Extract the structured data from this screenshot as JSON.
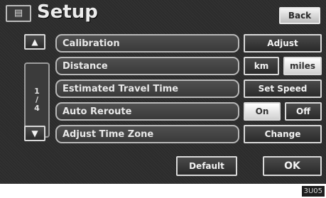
{
  "header": {
    "icon": "menu-list-icon",
    "title": "Setup",
    "back_label": "Back"
  },
  "pager": {
    "up_icon": "arrow-up-icon",
    "down_icon": "arrow-down-icon",
    "current": "1",
    "separator": "/",
    "total": "4"
  },
  "rows": [
    {
      "label": "Calibration",
      "buttons": [
        "Adjust"
      ]
    },
    {
      "label": "Distance",
      "buttons": [
        "km",
        "miles"
      ],
      "selected": "miles"
    },
    {
      "label": "Estimated Travel Time",
      "buttons": [
        "Set Speed"
      ]
    },
    {
      "label": "Auto Reroute",
      "buttons": [
        "On",
        "Off"
      ],
      "selected": "On"
    },
    {
      "label": "Adjust Time Zone",
      "buttons": [
        "Change"
      ]
    }
  ],
  "footer": {
    "default_label": "Default",
    "ok_label": "OK"
  },
  "image_code": "3U05"
}
